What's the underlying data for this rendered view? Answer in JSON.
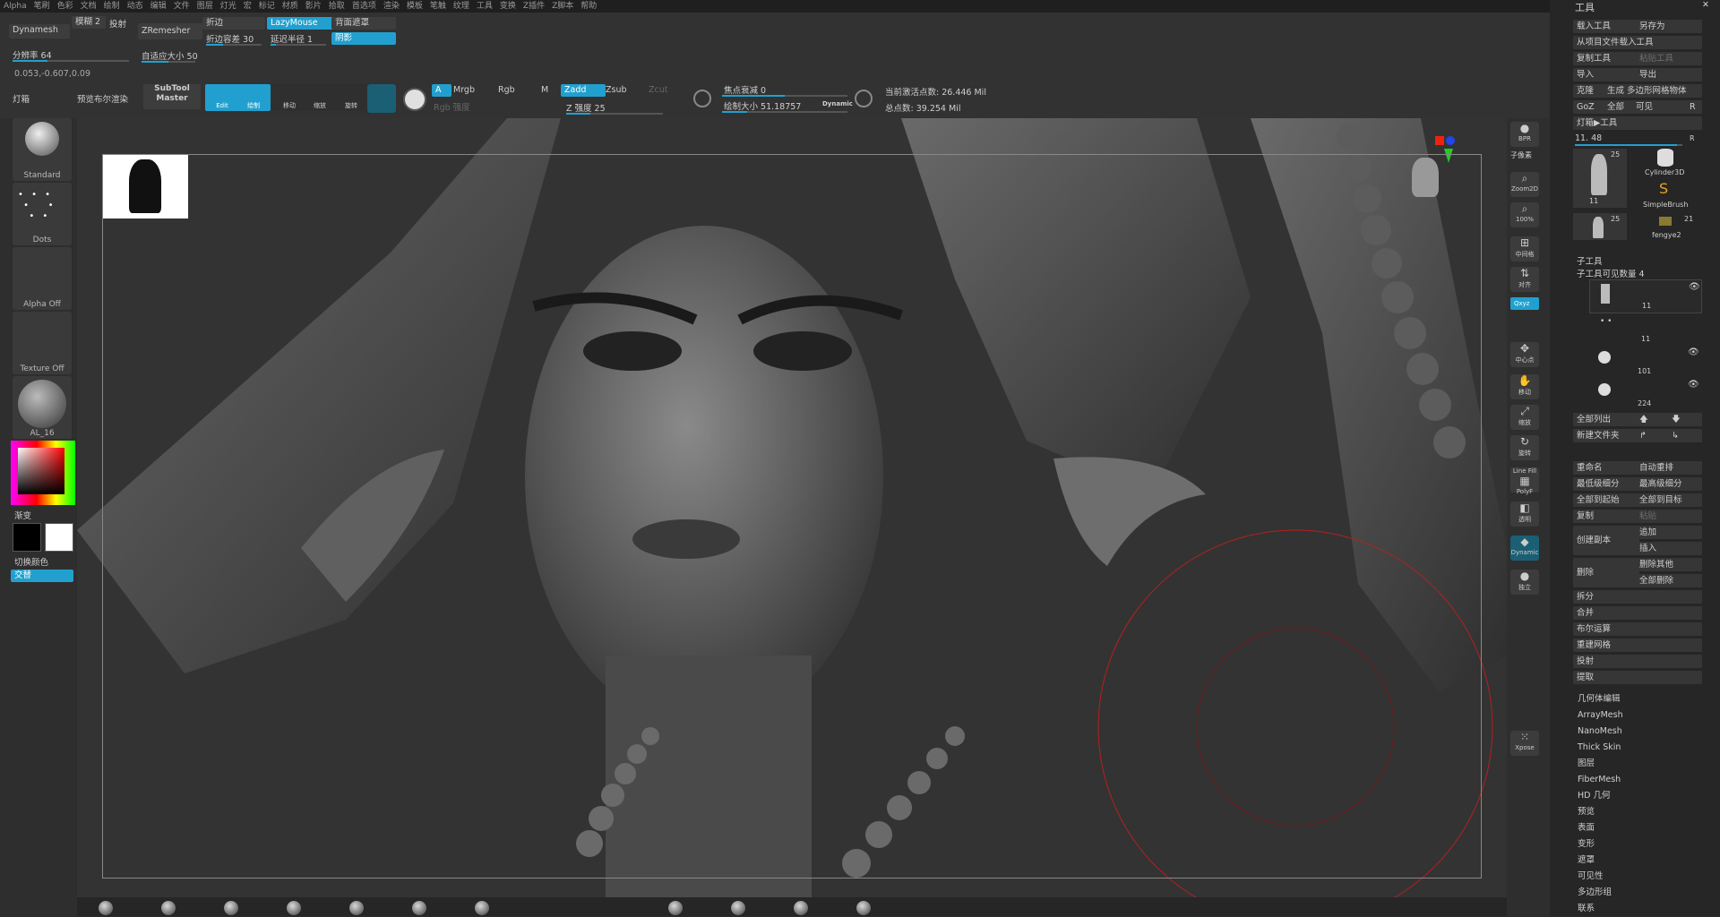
{
  "menu": [
    "Alpha",
    "笔刷",
    "色彩",
    "文档",
    "绘制",
    "动态",
    "编辑",
    "文件",
    "图层",
    "灯光",
    "宏",
    "标记",
    "材质",
    "影片",
    "拾取",
    "首选项",
    "渲染",
    "模板",
    "笔触",
    "纹理",
    "工具",
    "变换",
    "Z插件",
    "Z脚本",
    "帮助"
  ],
  "toolbar": {
    "dynamesh": "Dynamesh",
    "blur_label": "模糊 2",
    "project_label": "投射",
    "resolution": "分辨率 64",
    "coords": "0.053,-0.607,0.09",
    "zremesher": "ZRemesher",
    "adaptive": "自适应大小 50",
    "fold": "折边",
    "fold_tol": "折边容差 30",
    "lazymouse": "LazyMouse",
    "lazy_radius": "延迟半径 1",
    "backface": "背面遮罩",
    "shadow": "阴影",
    "lightbox": "灯箱",
    "bpr_preview": "预览布尔渲染",
    "subtool_master": "SubTool Master",
    "edit": "Edit",
    "draw": "绘制",
    "move": "移动",
    "scale": "缩放",
    "rotate": "旋转",
    "a": "A",
    "mrgb": "Mrgb",
    "rgb": "Rgb",
    "m": "M",
    "rgb_intensity": "Rgb 强度",
    "zadd": "Zadd",
    "zsub": "Zsub",
    "zcut": "Zcut",
    "z_intensity": "Z 强度 25",
    "focal_shift": "焦点衰减 0",
    "draw_size": "绘制大小 51.18757",
    "dynamic": "Dynamic",
    "active_points": "当前激活点数: 26.446 Mil",
    "total_points": "总点数: 39.254 Mil"
  },
  "left": {
    "brush": "Standard",
    "stroke": "Dots",
    "alpha": "Alpha Off",
    "texture": "Texture Off",
    "material": "AL_16",
    "gradient": "渐变",
    "switch_color": "切换颜色",
    "alternate": "交替"
  },
  "right_tools": [
    "BPR",
    "子像素",
    "Zoom2D",
    "100%",
    "中间格",
    "对齐",
    "Qxyz",
    "中心点",
    "移动",
    "缩放",
    "旋转",
    "Line Fill",
    "PolyF",
    "透明",
    "Dynamic",
    "独立",
    "Xpose"
  ],
  "panel": {
    "title": "工具",
    "load_tool": "载入工具",
    "save_as": "另存为",
    "load_from_project": "从项目文件载入工具",
    "copy_tool": "复制工具",
    "paste_tool": "粘贴工具",
    "import": "导入",
    "export": "导出",
    "clone": "克隆",
    "make_polymesh": "生成 多边形网格物体",
    "goz": "GoZ",
    "all": "全部",
    "visible": "可见",
    "r": "R",
    "lightbox_tools": "灯箱▶工具",
    "value": "11. 48",
    "thumbs": [
      {
        "name": "11",
        "count": "25"
      },
      {
        "name": "Cylinder3D",
        "count": ""
      },
      {
        "name": "SimpleBrush",
        "count": ""
      },
      {
        "name": "",
        "count": "25"
      },
      {
        "name": "fengye2",
        "count": "21"
      }
    ],
    "subtool_title": "子工具",
    "visible_count": "子工具可见数量 4",
    "subtools": [
      "11",
      "11",
      "101",
      "224"
    ],
    "list_all": "全部列出",
    "new_folder": "新建文件夹",
    "rename": "重命名",
    "auto_reorder": "自动重排",
    "lowest_sub": "最低级细分",
    "highest_sub": "最高级细分",
    "all_to_start": "全部到起始",
    "all_to_target": "全部到目标",
    "copy": "复制",
    "paste": "粘贴",
    "create_copy": "创建副本",
    "append": "追加",
    "insert": "插入",
    "delete": "删除",
    "delete_other": "删除其他",
    "delete_all": "全部删除",
    "split": "拆分",
    "merge": "合并",
    "boolean": "布尔运算",
    "remesh": "重建网格",
    "project": "投射",
    "extract": "提取",
    "sections": [
      "几何体编辑",
      "ArrayMesh",
      "NanoMesh",
      "Thick Skin",
      "图层",
      "FiberMesh",
      "HD 几何",
      "预览",
      "表面",
      "变形",
      "遮罩",
      "可见性",
      "多边形组",
      "联系"
    ]
  },
  "colors": {
    "accent": "#21a0cf",
    "bg": "#2c2c2c",
    "panel": "#262626"
  }
}
